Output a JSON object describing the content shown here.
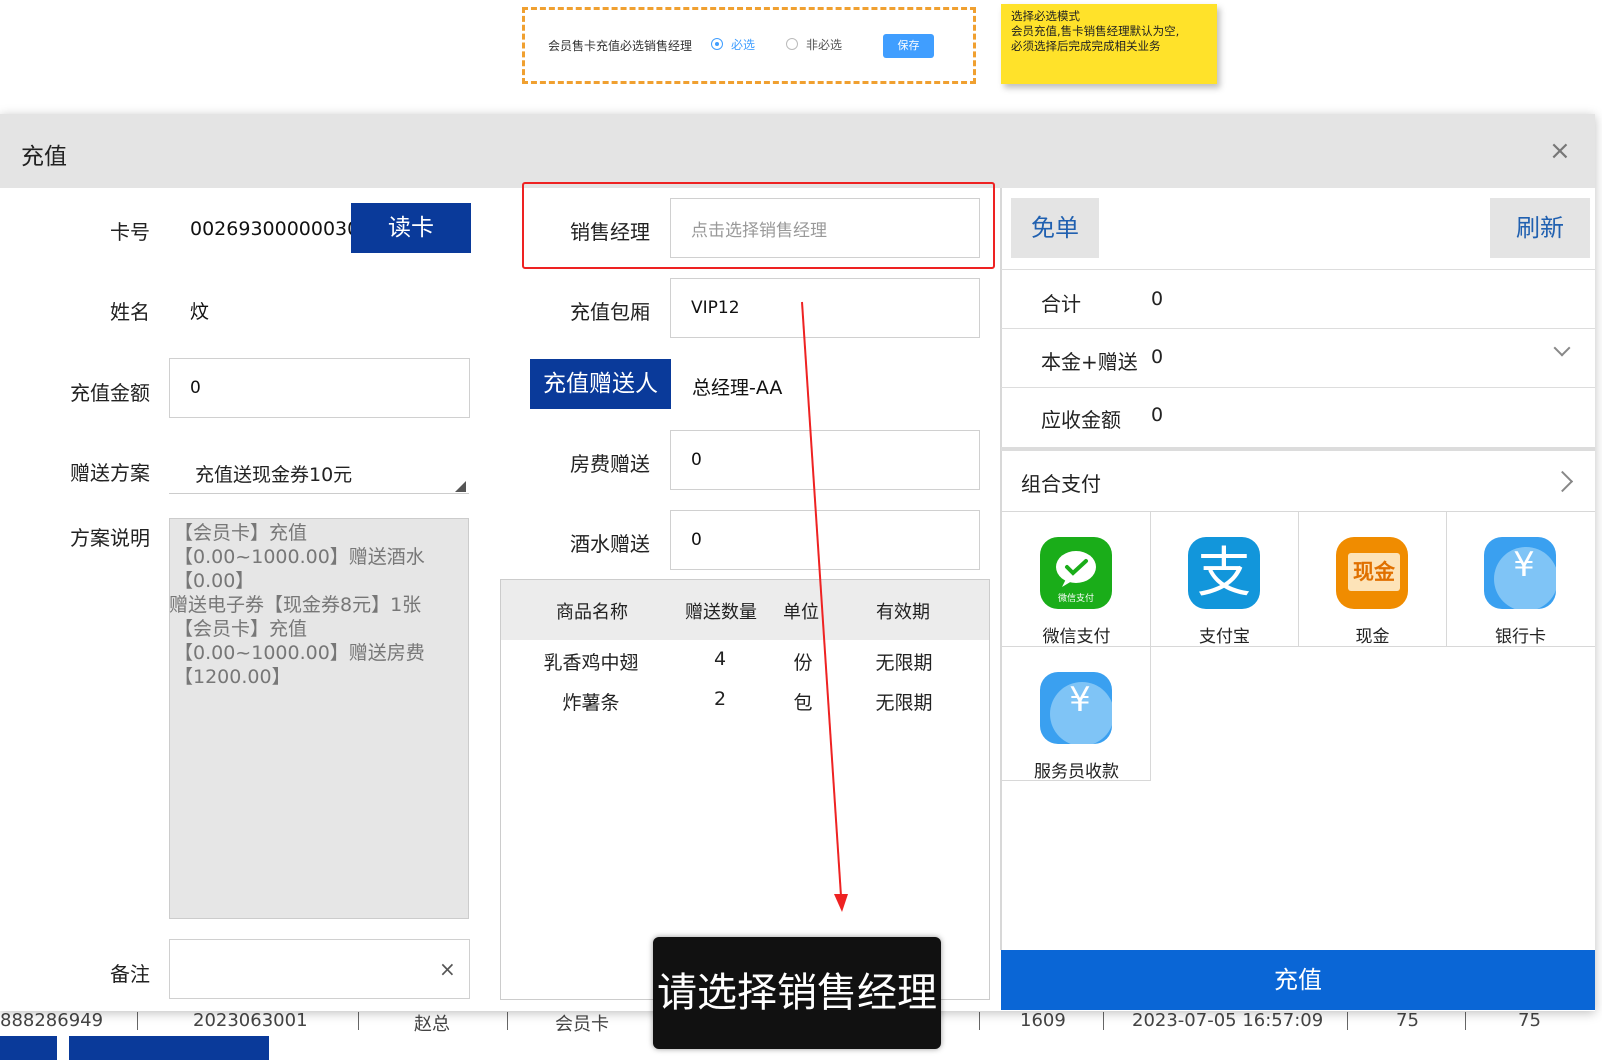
{
  "setting": {
    "label": "会员售卡充值必选销售经理",
    "option_required": "必选",
    "option_optional": "非必选",
    "save": "保存"
  },
  "note": {
    "line1": "选择必选模式",
    "line2": "会员充值,售卡销售经理默认为空,",
    "line3": "必须选择后完成完成相关业务"
  },
  "background_table": {
    "cells": [
      "888286949",
      "2023063001",
      "赵总",
      "会员卡",
      "1609",
      "2023-07-05 16:57:09",
      "75",
      "75"
    ],
    "buttons": [
      "",
      ""
    ]
  },
  "dialog": {
    "title": "充值",
    "close": "×"
  },
  "left": {
    "card_label": "卡号",
    "card_value": "00269300000030",
    "read_card": "读卡",
    "name_label": "姓名",
    "name_value": "炆",
    "amount_label": "充值金额",
    "amount_value": "0",
    "scheme_label": "赠送方案",
    "scheme_value": "充值送现金券10元",
    "desc_label": "方案说明",
    "desc_lines": [
      "【会员卡】充值",
      "【0.00~1000.00】赠送酒水",
      "【0.00】",
      "赠送电子券【现金券8元】1张",
      "【会员卡】充值",
      "【0.00~1000.00】赠送房费",
      "【1200.00】"
    ],
    "remark_label": "备注",
    "remark_clear": "×"
  },
  "middle": {
    "manager_label": "销售经理",
    "manager_placeholder": "点击选择销售经理",
    "room_label": "充值包厢",
    "room_value": "VIP12",
    "gifter_button": "充值赠送人",
    "gifter_value": "总经理-AA",
    "room_fee_label": "房费赠送",
    "room_fee_value": "0",
    "drink_label": "酒水赠送",
    "drink_value": "0",
    "gift_table": {
      "headers": [
        "商品名称",
        "赠送数量",
        "单位",
        "有效期"
      ],
      "rows": [
        [
          "乳香鸡中翅",
          "4",
          "份",
          "无限期"
        ],
        [
          "炸薯条",
          "2",
          "包",
          "无限期"
        ]
      ]
    }
  },
  "right": {
    "free_order": "免单",
    "refresh": "刷新",
    "total_label": "合计",
    "total_value": "0",
    "principal_label": "本金+赠送",
    "principal_value": "0",
    "receivable_label": "应收金额",
    "receivable_value": "0",
    "combo_pay": "组合支付",
    "payments": [
      {
        "label": "微信支付",
        "icon": "wechat-pay-icon",
        "color": "#1aad19",
        "badge": "微信支付"
      },
      {
        "label": "支付宝",
        "icon": "alipay-icon",
        "color": "#1296db",
        "badge": "支"
      },
      {
        "label": "现金",
        "icon": "cash-icon",
        "color": "#f08c00",
        "badge": "现金"
      },
      {
        "label": "银行卡",
        "icon": "bank-card-icon",
        "color": "#3aa0f0",
        "badge": "¥"
      },
      {
        "label": "服务员收款",
        "icon": "waiter-collect-icon",
        "color": "#3aa0f0",
        "badge": "¥"
      }
    ],
    "recharge": "充值"
  },
  "toast": {
    "text": "请选择销售经理"
  },
  "colors": {
    "dark_blue": "#0a3a9a",
    "primary_blue": "#0a66d6",
    "highlight_red": "#ee2222",
    "note_yellow": "#ffe22a",
    "dashed_orange": "#f0a030"
  }
}
